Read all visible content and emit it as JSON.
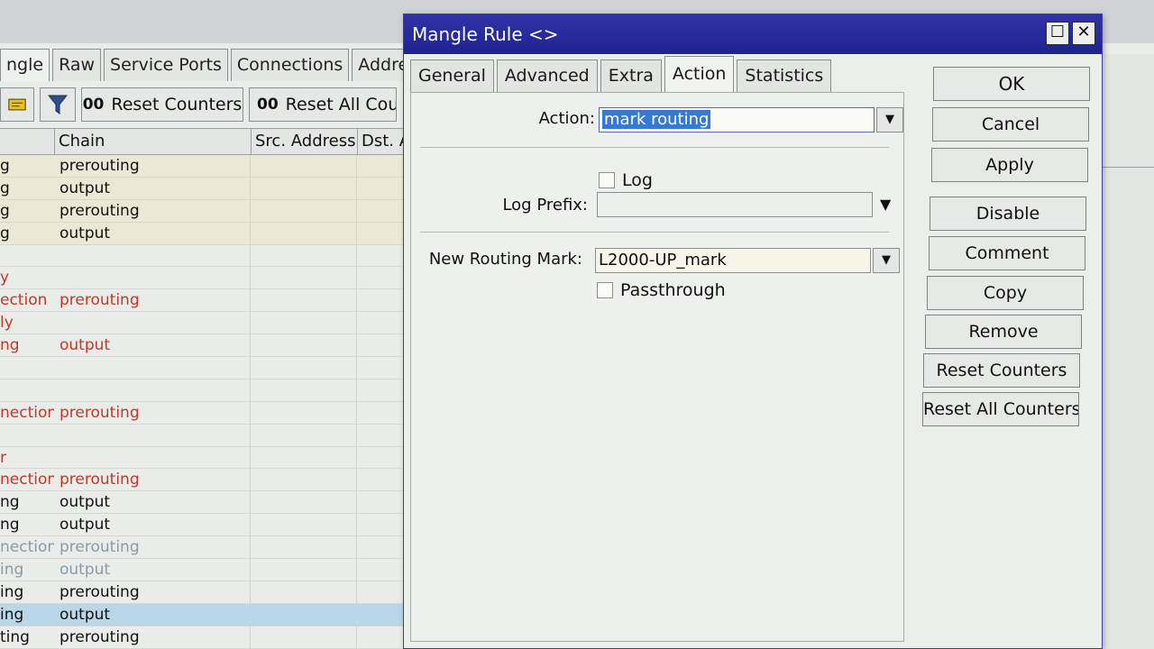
{
  "background_window": {
    "tabs": [
      "ngle",
      "Raw",
      "Service Ports",
      "Connections",
      "Address Lis"
    ],
    "toolbar": {
      "reset_counters": "Reset Counters",
      "reset_all_counters": "Reset All Coun",
      "oo": "00"
    },
    "table": {
      "columns": [
        "",
        "Chain",
        "Src. Address",
        "Dst. A"
      ],
      "rows": [
        {
          "action": "g",
          "chain": "prerouting",
          "style": "yellow"
        },
        {
          "action": "g",
          "chain": "output",
          "style": "yellow"
        },
        {
          "action": "g",
          "chain": "prerouting",
          "style": "yellow"
        },
        {
          "action": "g",
          "chain": "output",
          "style": "yellow"
        },
        {
          "action": "",
          "chain": "",
          "style": ""
        },
        {
          "action": "y",
          "chain": "",
          "style": "red"
        },
        {
          "action": "ection",
          "chain": "prerouting",
          "style": "red"
        },
        {
          "action": "ly",
          "chain": "",
          "style": "red"
        },
        {
          "action": "ng",
          "chain": "output",
          "style": "red"
        },
        {
          "action": "",
          "chain": "",
          "style": ""
        },
        {
          "action": "",
          "chain": "",
          "style": ""
        },
        {
          "action": "nection",
          "chain": "prerouting",
          "style": "red"
        },
        {
          "action": "",
          "chain": "",
          "style": ""
        },
        {
          "action": "r",
          "chain": "",
          "style": "red"
        },
        {
          "action": "nection",
          "chain": "prerouting",
          "style": "red"
        },
        {
          "action": "ng",
          "chain": "output",
          "style": ""
        },
        {
          "action": "ng",
          "chain": "output",
          "style": ""
        },
        {
          "action": "nection",
          "chain": "prerouting",
          "style": "grey"
        },
        {
          "action": "ing",
          "chain": "output",
          "style": "grey"
        },
        {
          "action": "ing",
          "chain": "prerouting",
          "style": ""
        },
        {
          "action": "ing",
          "chain": "output",
          "style": "sel"
        },
        {
          "action": "ting",
          "chain": "prerouting",
          "style": ""
        }
      ]
    }
  },
  "dialog": {
    "title": "Mangle Rule <>",
    "title_buttons": {
      "maximize": "☐",
      "close": "✕"
    },
    "tabs": [
      {
        "label": "General",
        "active": false
      },
      {
        "label": "Advanced",
        "active": false
      },
      {
        "label": "Extra",
        "active": false
      },
      {
        "label": "Action",
        "active": true
      },
      {
        "label": "Statistics",
        "active": false
      }
    ],
    "form": {
      "action_label": "Action:",
      "action_value": "mark routing",
      "log_label": "Log",
      "log_checked": false,
      "log_prefix_label": "Log Prefix:",
      "log_prefix_value": "",
      "new_routing_mark_label": "New Routing Mark:",
      "new_routing_mark_value": "L2000-UP_mark",
      "passthrough_label": "Passthrough",
      "passthrough_checked": false
    },
    "buttons": {
      "ok": "OK",
      "cancel": "Cancel",
      "apply": "Apply",
      "disable": "Disable",
      "comment": "Comment",
      "copy": "Copy",
      "remove": "Remove",
      "reset_counters": "Reset Counters",
      "reset_all_counters": "Reset All Counters"
    }
  }
}
